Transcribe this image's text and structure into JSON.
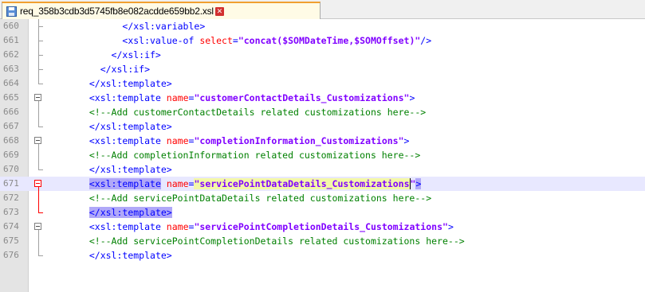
{
  "tab": {
    "filename": "req_358b3cdb3d5745fb8e082acdde659bb2.xsl",
    "icon": "save-disk-icon",
    "close_glyph": "✕"
  },
  "colors": {
    "tag": "#0000ff",
    "attr": "#ff0000",
    "value": "#8000ff",
    "comment": "#008000",
    "current_line": "#e8e8ff",
    "match_highlight": "#b0a8f8"
  },
  "lines": [
    {
      "num": "660",
      "indent": "        ",
      "tokens": [
        {
          "t": "tag",
          "v": "</xsl:variable>"
        }
      ]
    },
    {
      "num": "661",
      "indent": "        ",
      "tokens": [
        {
          "t": "tag",
          "v": "<xsl:value-of "
        },
        {
          "t": "attr",
          "v": "select"
        },
        {
          "t": "punct",
          "v": "="
        },
        {
          "t": "val",
          "v": "\"concat($SOMDateTime,$SOMOffset)\""
        },
        {
          "t": "tag",
          "v": "/>"
        }
      ]
    },
    {
      "num": "662",
      "indent": "      ",
      "tokens": [
        {
          "t": "tag",
          "v": "</xsl:if>"
        }
      ]
    },
    {
      "num": "663",
      "indent": "    ",
      "tokens": [
        {
          "t": "tag",
          "v": "</xsl:if>"
        }
      ]
    },
    {
      "num": "664",
      "indent": "  ",
      "tokens": [
        {
          "t": "tag",
          "v": "</xsl:template>"
        }
      ]
    },
    {
      "num": "665",
      "indent": "  ",
      "tokens": [
        {
          "t": "tag",
          "v": "<xsl:template "
        },
        {
          "t": "attr",
          "v": "name"
        },
        {
          "t": "punct",
          "v": "="
        },
        {
          "t": "val",
          "v": "\"customerContactDetails_Customizations\""
        },
        {
          "t": "tag",
          "v": ">"
        }
      ]
    },
    {
      "num": "666",
      "indent": "  ",
      "tokens": [
        {
          "t": "comment",
          "v": "<!--Add customerContactDetails related customizations here-->"
        }
      ]
    },
    {
      "num": "667",
      "indent": "  ",
      "tokens": [
        {
          "t": "tag",
          "v": "</xsl:template>"
        }
      ]
    },
    {
      "num": "668",
      "indent": "  ",
      "tokens": [
        {
          "t": "tag",
          "v": "<xsl:template "
        },
        {
          "t": "attr",
          "v": "name"
        },
        {
          "t": "punct",
          "v": "="
        },
        {
          "t": "val",
          "v": "\"completionInformation_Customizations\""
        },
        {
          "t": "tag",
          "v": ">"
        }
      ]
    },
    {
      "num": "669",
      "indent": "  ",
      "tokens": [
        {
          "t": "comment",
          "v": "<!--Add completionInformation related customizations here-->"
        }
      ]
    },
    {
      "num": "670",
      "indent": "  ",
      "tokens": [
        {
          "t": "tag",
          "v": "</xsl:template>"
        }
      ]
    },
    {
      "num": "671",
      "indent": "  ",
      "current": true,
      "tokens": [
        {
          "t": "tag",
          "v": "<xsl:template",
          "hl": "match"
        },
        {
          "t": "tag",
          "v": " "
        },
        {
          "t": "attr",
          "v": "name"
        },
        {
          "t": "punct",
          "v": "="
        },
        {
          "t": "val",
          "v": "\"",
          "hl": "sel"
        },
        {
          "t": "val",
          "v": "servicePointDataDetails_Customizations",
          "hl": "sel"
        },
        {
          "t": "cursor",
          "v": ""
        },
        {
          "t": "val",
          "v": "\""
        },
        {
          "t": "tag",
          "v": ">",
          "hl": "match"
        }
      ]
    },
    {
      "num": "672",
      "indent": "  ",
      "tokens": [
        {
          "t": "comment",
          "v": "<!--Add servicePointDataDetails related customizations here-->"
        }
      ]
    },
    {
      "num": "673",
      "indent": "  ",
      "tokens": [
        {
          "t": "tag",
          "v": "</xsl:template>",
          "hl": "match"
        }
      ]
    },
    {
      "num": "674",
      "indent": "  ",
      "tokens": [
        {
          "t": "tag",
          "v": "<xsl:template "
        },
        {
          "t": "attr",
          "v": "name"
        },
        {
          "t": "punct",
          "v": "="
        },
        {
          "t": "val",
          "v": "\"servicePointCompletionDetails_Customizations\""
        },
        {
          "t": "tag",
          "v": ">"
        }
      ]
    },
    {
      "num": "675",
      "indent": "  ",
      "tokens": [
        {
          "t": "comment",
          "v": "<!--Add servicePointCompletionDetails related customizations here-->"
        }
      ]
    },
    {
      "num": "676",
      "indent": "  ",
      "tokens": [
        {
          "t": "tag",
          "v": "</xsl:template>"
        }
      ]
    }
  ]
}
